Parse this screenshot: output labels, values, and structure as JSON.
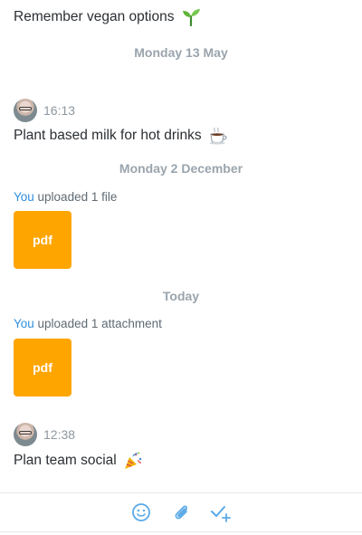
{
  "messages": {
    "m1_text": "Remember vegan options",
    "sep1": "Monday 13 May",
    "m2_time": "16:13",
    "m2_text": "Plant based milk for hot drinks",
    "sep2": "Monday 2 December",
    "u1_you": "You",
    "u1_text": " uploaded 1 file",
    "u1_file": "pdf",
    "sep3": "Today",
    "u2_you": "You",
    "u2_text": " uploaded 1 attachment",
    "u2_file": "pdf",
    "m3_time": "12:38",
    "m3_text": "Plan team social"
  },
  "icons": {
    "emoji_seedling": "seedling-icon",
    "emoji_hot_drink": "hot-beverage-icon",
    "emoji_party": "party-popper-icon",
    "composer_emoji": "smiley-icon",
    "composer_attach": "paperclip-icon",
    "composer_task": "add-task-icon"
  },
  "colors": {
    "accent": "#2f8fe0",
    "file_tile": "#ffa500",
    "icon_blue": "#5aa9e6",
    "muted": "#9aa4ad"
  }
}
